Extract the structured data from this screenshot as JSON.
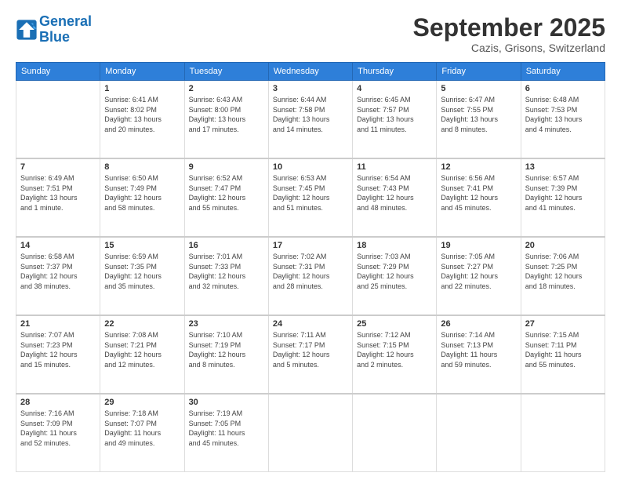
{
  "header": {
    "logo_line1": "General",
    "logo_line2": "Blue",
    "month": "September 2025",
    "location": "Cazis, Grisons, Switzerland"
  },
  "weekdays": [
    "Sunday",
    "Monday",
    "Tuesday",
    "Wednesday",
    "Thursday",
    "Friday",
    "Saturday"
  ],
  "weeks": [
    [
      {
        "day": "",
        "info": ""
      },
      {
        "day": "1",
        "info": "Sunrise: 6:41 AM\nSunset: 8:02 PM\nDaylight: 13 hours\nand 20 minutes."
      },
      {
        "day": "2",
        "info": "Sunrise: 6:43 AM\nSunset: 8:00 PM\nDaylight: 13 hours\nand 17 minutes."
      },
      {
        "day": "3",
        "info": "Sunrise: 6:44 AM\nSunset: 7:58 PM\nDaylight: 13 hours\nand 14 minutes."
      },
      {
        "day": "4",
        "info": "Sunrise: 6:45 AM\nSunset: 7:57 PM\nDaylight: 13 hours\nand 11 minutes."
      },
      {
        "day": "5",
        "info": "Sunrise: 6:47 AM\nSunset: 7:55 PM\nDaylight: 13 hours\nand 8 minutes."
      },
      {
        "day": "6",
        "info": "Sunrise: 6:48 AM\nSunset: 7:53 PM\nDaylight: 13 hours\nand 4 minutes."
      }
    ],
    [
      {
        "day": "7",
        "info": "Sunrise: 6:49 AM\nSunset: 7:51 PM\nDaylight: 13 hours\nand 1 minute."
      },
      {
        "day": "8",
        "info": "Sunrise: 6:50 AM\nSunset: 7:49 PM\nDaylight: 12 hours\nand 58 minutes."
      },
      {
        "day": "9",
        "info": "Sunrise: 6:52 AM\nSunset: 7:47 PM\nDaylight: 12 hours\nand 55 minutes."
      },
      {
        "day": "10",
        "info": "Sunrise: 6:53 AM\nSunset: 7:45 PM\nDaylight: 12 hours\nand 51 minutes."
      },
      {
        "day": "11",
        "info": "Sunrise: 6:54 AM\nSunset: 7:43 PM\nDaylight: 12 hours\nand 48 minutes."
      },
      {
        "day": "12",
        "info": "Sunrise: 6:56 AM\nSunset: 7:41 PM\nDaylight: 12 hours\nand 45 minutes."
      },
      {
        "day": "13",
        "info": "Sunrise: 6:57 AM\nSunset: 7:39 PM\nDaylight: 12 hours\nand 41 minutes."
      }
    ],
    [
      {
        "day": "14",
        "info": "Sunrise: 6:58 AM\nSunset: 7:37 PM\nDaylight: 12 hours\nand 38 minutes."
      },
      {
        "day": "15",
        "info": "Sunrise: 6:59 AM\nSunset: 7:35 PM\nDaylight: 12 hours\nand 35 minutes."
      },
      {
        "day": "16",
        "info": "Sunrise: 7:01 AM\nSunset: 7:33 PM\nDaylight: 12 hours\nand 32 minutes."
      },
      {
        "day": "17",
        "info": "Sunrise: 7:02 AM\nSunset: 7:31 PM\nDaylight: 12 hours\nand 28 minutes."
      },
      {
        "day": "18",
        "info": "Sunrise: 7:03 AM\nSunset: 7:29 PM\nDaylight: 12 hours\nand 25 minutes."
      },
      {
        "day": "19",
        "info": "Sunrise: 7:05 AM\nSunset: 7:27 PM\nDaylight: 12 hours\nand 22 minutes."
      },
      {
        "day": "20",
        "info": "Sunrise: 7:06 AM\nSunset: 7:25 PM\nDaylight: 12 hours\nand 18 minutes."
      }
    ],
    [
      {
        "day": "21",
        "info": "Sunrise: 7:07 AM\nSunset: 7:23 PM\nDaylight: 12 hours\nand 15 minutes."
      },
      {
        "day": "22",
        "info": "Sunrise: 7:08 AM\nSunset: 7:21 PM\nDaylight: 12 hours\nand 12 minutes."
      },
      {
        "day": "23",
        "info": "Sunrise: 7:10 AM\nSunset: 7:19 PM\nDaylight: 12 hours\nand 8 minutes."
      },
      {
        "day": "24",
        "info": "Sunrise: 7:11 AM\nSunset: 7:17 PM\nDaylight: 12 hours\nand 5 minutes."
      },
      {
        "day": "25",
        "info": "Sunrise: 7:12 AM\nSunset: 7:15 PM\nDaylight: 12 hours\nand 2 minutes."
      },
      {
        "day": "26",
        "info": "Sunrise: 7:14 AM\nSunset: 7:13 PM\nDaylight: 11 hours\nand 59 minutes."
      },
      {
        "day": "27",
        "info": "Sunrise: 7:15 AM\nSunset: 7:11 PM\nDaylight: 11 hours\nand 55 minutes."
      }
    ],
    [
      {
        "day": "28",
        "info": "Sunrise: 7:16 AM\nSunset: 7:09 PM\nDaylight: 11 hours\nand 52 minutes."
      },
      {
        "day": "29",
        "info": "Sunrise: 7:18 AM\nSunset: 7:07 PM\nDaylight: 11 hours\nand 49 minutes."
      },
      {
        "day": "30",
        "info": "Sunrise: 7:19 AM\nSunset: 7:05 PM\nDaylight: 11 hours\nand 45 minutes."
      },
      {
        "day": "",
        "info": ""
      },
      {
        "day": "",
        "info": ""
      },
      {
        "day": "",
        "info": ""
      },
      {
        "day": "",
        "info": ""
      }
    ]
  ]
}
